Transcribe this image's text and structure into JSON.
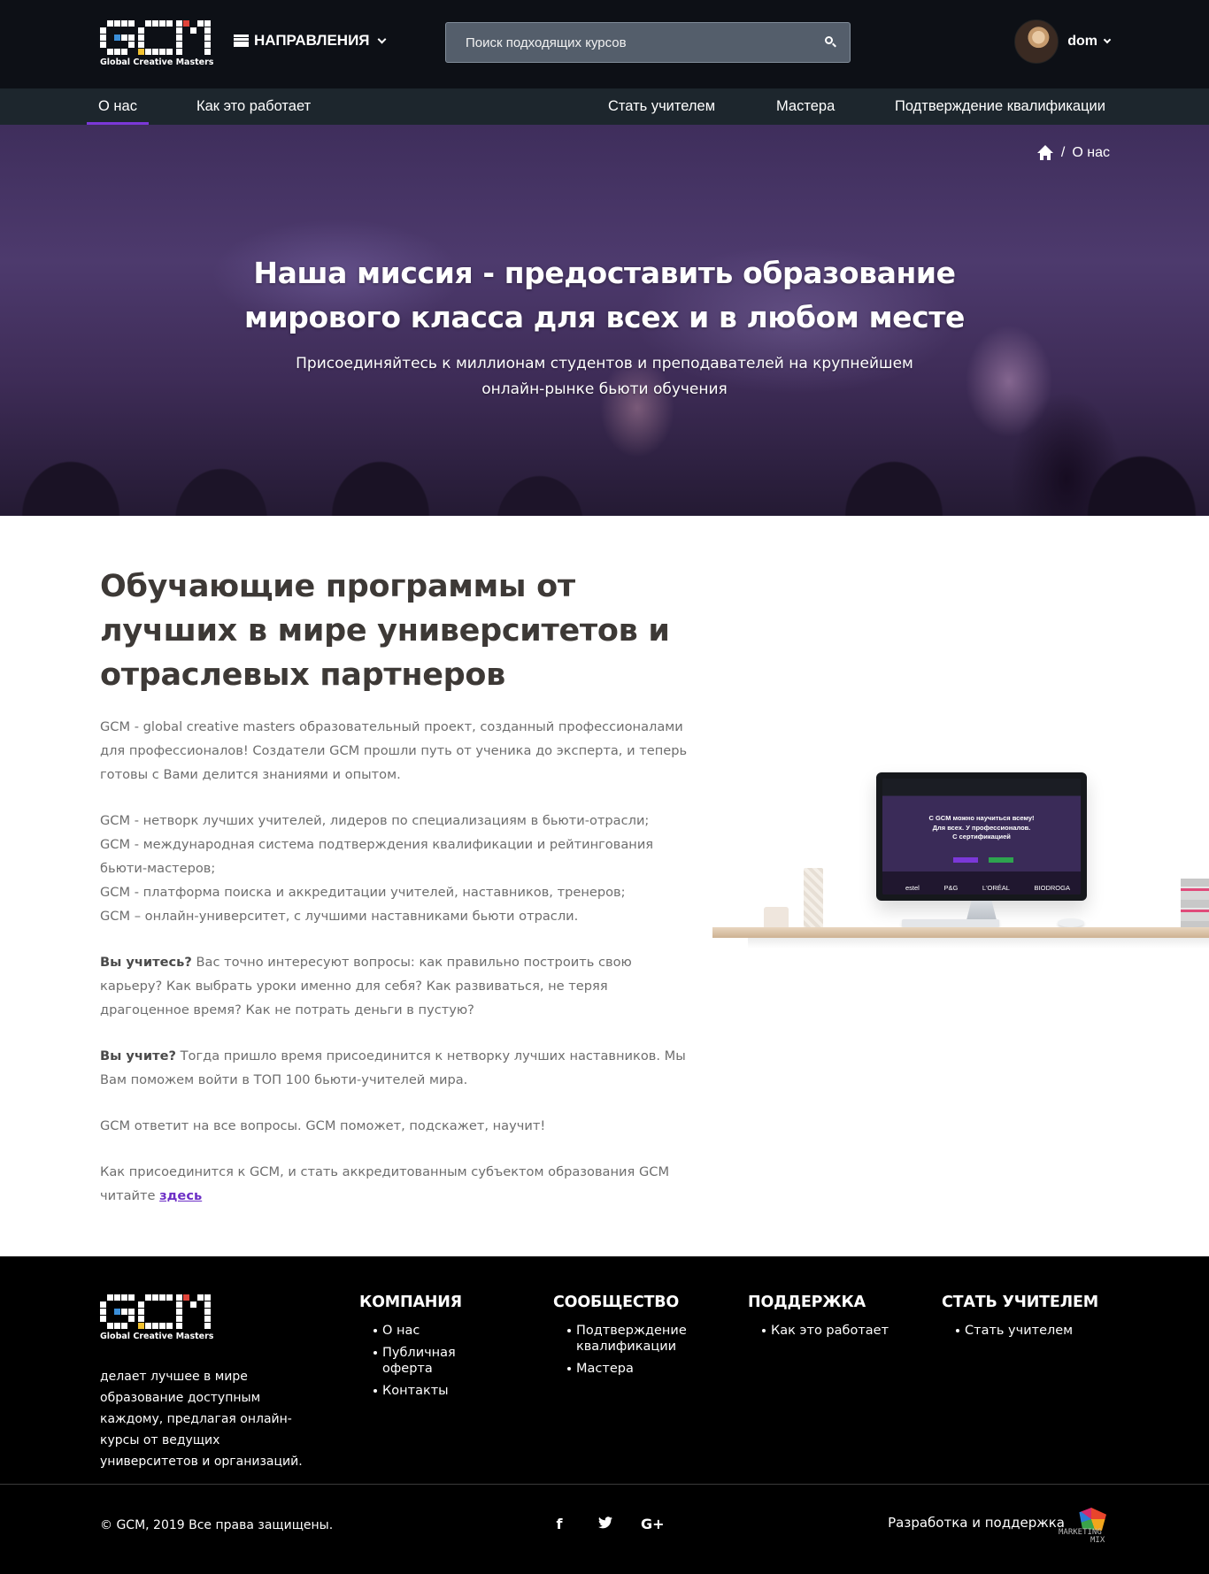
{
  "brand": {
    "logo_text": "GCM",
    "logo_subtitle": "Global Creative Masters",
    "colors": {
      "white": "#ffffff",
      "blue": "#3b8fd9",
      "yellow": "#f2c230",
      "red": "#e0443a"
    }
  },
  "header": {
    "directions_label": "НАПРАВЛЕНИЯ",
    "directions_icon": "list-icon",
    "search_placeholder": "Поиск подходящих курсов",
    "search_icon": "search-icon",
    "username": "dom"
  },
  "subnav": {
    "left": [
      {
        "label": "О нас",
        "active": true
      },
      {
        "label": "Как это работает"
      }
    ],
    "right": [
      {
        "label": "Стать учителем"
      },
      {
        "label": "Мастера"
      },
      {
        "label": "Подтверждение квалификации"
      }
    ],
    "accent_color": "#7b38d8"
  },
  "hero": {
    "breadcrumb_home_icon": "home-icon",
    "breadcrumb_separator": "/",
    "breadcrumb_current": "О нас",
    "title": "Наша миссия - предоставить образование мирового класса для всех и в любом месте",
    "subtitle": "Присоединяйтесь к миллионам студентов и преподавателей на крупнейшем онлайн-рынке бьюти обучения"
  },
  "about": {
    "heading": "Обучающие программы от лучших в мире университетов и отраслевых партнеров",
    "p1": "GCM - global creative masters образовательный проект, созданный профессионалами для профессионалов! Создатели GCM прошли путь от ученика до эксперта, и теперь готовы с Вами делится знаниями и опытом.",
    "list": [
      "GCM - нетворк лучших учителей, лидеров по специализациям в бьюти-отрасли;",
      "GCM - международная система подтверждения квалификации и рейтингования бьюти-мастеров;",
      "GCM - платформа поиска и аккредитации учителей, наставников, тренеров;",
      "GCM – онлайн-университет, с лучшими наставниками бьюти отрасли."
    ],
    "p3_bold": "Вы учитесь?",
    "p3_text": " Вас точно интересуют вопросы: как правильно построить свою карьеру? Как выбрать уроки именно для себя? Как развиваться, не теряя драгоценное время? Как не потрать деньги в пустую?",
    "p4_bold": "Вы учите?",
    "p4_text": " Тогда пришло время присоединится к нетворку лучших наставников. Мы Вам поможем войти в ТОП 100 бьюти-учителей мира.",
    "p5": "GCM ответит на все вопросы. GCM поможет, подскажет, научит!",
    "p6_text": "Как присоединится к GCM, и стать аккредитованным субъектом образования GCM читайте ",
    "p6_link": "здесь",
    "link_color": "#6d2fc6"
  },
  "screen_mockup": {
    "line1": "С GCM можно научиться всему!",
    "line2": "Для всех. У профессионалов.",
    "line3": "С сертификацией",
    "brands": [
      "estel",
      "P&G",
      "L'ORÉAL",
      "BIODROGA"
    ]
  },
  "footer": {
    "about": "делает лучшее в мире образование доступным каждому, предлагая онлайн-курсы от ведущих университетов и организаций.",
    "columns": [
      {
        "title": "КОМПАНИЯ",
        "links": [
          "О нас",
          "Публичная оферта",
          "Контакты"
        ]
      },
      {
        "title": "СООБЩЕСТВО",
        "links": [
          "Подтверждение квалификации",
          "Мастера"
        ]
      },
      {
        "title": "ПОДДЕРЖКА",
        "links": [
          "Как это работает"
        ]
      },
      {
        "title": "СТАТЬ УЧИТЕЛЕМ",
        "links": [
          "Стать учителем"
        ]
      }
    ],
    "copyright": "© GCM, 2019 Все права защищены.",
    "socials": [
      {
        "icon": "facebook-icon",
        "glyph": "f"
      },
      {
        "icon": "twitter-icon",
        "glyph": "t"
      },
      {
        "icon": "google-plus-icon",
        "glyph": "G+"
      }
    ],
    "developed_by": "Разработка и поддержка",
    "developer_logo_line1": "MARKETING",
    "developer_logo_line2": "MIX"
  }
}
